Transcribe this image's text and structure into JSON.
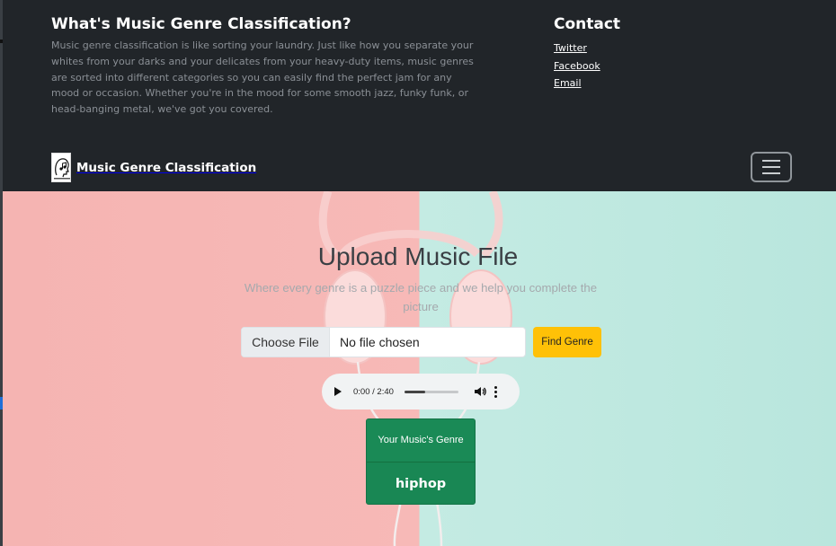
{
  "about": {
    "title": "What's Music Genre Classification?",
    "text": "Music genre classification is like sorting your laundry. Just like how you separate your whites from your darks and your delicates from your heavy-duty items, music genres are sorted into different categories so you can easily find the perfect jam for any mood or occasion. Whether you're in the mood for some smooth jazz, funky funk, or head-banging metal, we've got you covered."
  },
  "contact": {
    "title": "Contact",
    "links": [
      "Twitter",
      "Facebook",
      "Email"
    ]
  },
  "navbar": {
    "brand": "Music Genre Classification",
    "logo_icon": "music-head-logo",
    "toggler_icon": "hamburger-icon"
  },
  "upload": {
    "title": "Upload Music File",
    "subtitle": "Where every genre is a puzzle piece and we help you complete the picture",
    "choose_label": "Choose File",
    "file_status": "No file chosen",
    "submit_label": "Find Genre"
  },
  "audio": {
    "time": "0:00 / 2:40",
    "progress": 0.38
  },
  "result": {
    "header": "Your Music's Genre",
    "genre": "hiphop"
  },
  "colors": {
    "dark": "#212529",
    "accent_yellow": "#ffc107",
    "success_green": "#198754",
    "bg_pink": "#f5b4b2",
    "bg_mint": "#c4ebe3"
  }
}
